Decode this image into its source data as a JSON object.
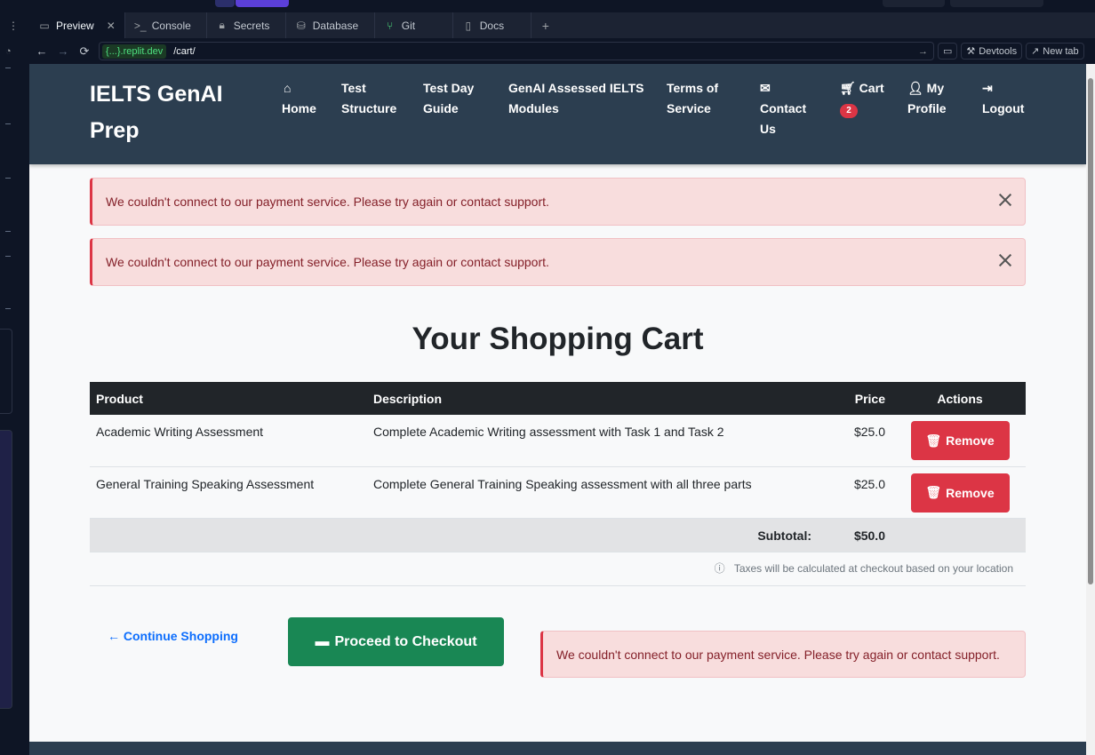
{
  "ide": {
    "tabs": [
      {
        "label": "Preview",
        "icon": "monitor-icon"
      },
      {
        "label": "Console",
        "icon": "terminal-icon"
      },
      {
        "label": "Secrets",
        "icon": "lock-icon"
      },
      {
        "label": "Database",
        "icon": "database-icon"
      },
      {
        "label": "Git",
        "icon": "git-icon"
      },
      {
        "label": "Docs",
        "icon": "book-icon"
      }
    ],
    "url": {
      "host": "{...}.replit.dev",
      "path": "/cart/"
    },
    "devtools_label": "Devtools",
    "newtab_label": "New tab"
  },
  "site": {
    "brand": "IELTS GenAI Prep",
    "nav": {
      "home": "Home",
      "test_structure": "Test Structure",
      "test_day_guide": "Test Day Guide",
      "modules": "GenAI Assessed IELTS Modules",
      "terms": "Terms of Service",
      "contact": "Contact Us",
      "cart": "Cart",
      "cart_count": "2",
      "profile": "My Profile",
      "logout": "Logout"
    }
  },
  "alerts": {
    "message": "We couldn't connect to our payment service. Please try again or contact support."
  },
  "cart": {
    "title": "Your Shopping Cart",
    "columns": {
      "product": "Product",
      "description": "Description",
      "price": "Price",
      "actions": "Actions"
    },
    "items": [
      {
        "product": "Academic Writing Assessment",
        "description": "Complete Academic Writing assessment with Task 1 and Task 2",
        "price": "$25.0"
      },
      {
        "product": "General Training Speaking Assessment",
        "description": "Complete General Training Speaking assessment with all three parts",
        "price": "$25.0"
      }
    ],
    "remove_label": "Remove",
    "subtotal_label": "Subtotal:",
    "subtotal_value": "$50.0",
    "tax_note": "Taxes will be calculated at checkout based on your location",
    "continue_label": "Continue Shopping",
    "checkout_label": "Proceed to Checkout"
  },
  "colors": {
    "nav_bg": "#2c3e50",
    "danger": "#dc3545",
    "success": "#198754",
    "link": "#0d6efd"
  }
}
